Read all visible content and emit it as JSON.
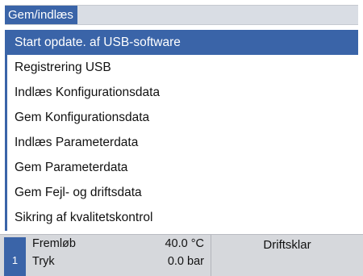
{
  "window": {
    "title": "Gem/indlæs"
  },
  "menu": {
    "items": [
      {
        "label": "Start opdate. af USB-software",
        "selected": true
      },
      {
        "label": "Registrering USB",
        "selected": false
      },
      {
        "label": "Indlæs Konfigurationsdata",
        "selected": false
      },
      {
        "label": "Gem Konfigurationsdata",
        "selected": false
      },
      {
        "label": "Indlæs Parameterdata",
        "selected": false
      },
      {
        "label": "Gem Parameterdata",
        "selected": false
      },
      {
        "label": "Gem Fejl- og driftsdata",
        "selected": false
      },
      {
        "label": "Sikring af kvalitetskontrol",
        "selected": false
      }
    ]
  },
  "status_bar": {
    "channel": "1",
    "readings": [
      {
        "label": "Fremløb",
        "value": "40.0 °C"
      },
      {
        "label": "Tryk",
        "value": "0.0 bar"
      }
    ],
    "state": "Driftsklar"
  },
  "colors": {
    "accent": "#3a64a8",
    "title_bar": "#d9dde4",
    "status_bar": "#d6d8dc",
    "text": "#111111"
  }
}
